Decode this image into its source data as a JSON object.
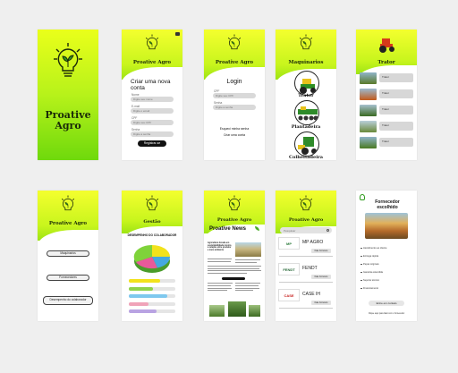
{
  "splash": {
    "title_line1": "Proative",
    "title_line2": "Agro"
  },
  "brand": {
    "name": "Proative Agro"
  },
  "register": {
    "heading": "Criar uma nova conta",
    "fields": [
      {
        "label": "Nome",
        "placeholder": "Digite seu nome"
      },
      {
        "label": "E-mail",
        "placeholder": "Digite o email"
      },
      {
        "label": "CPF",
        "placeholder": "Digite seu CPF"
      },
      {
        "label": "Senha",
        "placeholder": "Digite a senha"
      }
    ],
    "submit": "Registrar-se"
  },
  "login": {
    "heading": "Login",
    "fields": [
      {
        "label": "CPF",
        "placeholder": "Digite seu CPF"
      },
      {
        "label": "Senha",
        "placeholder": "Digite a senha"
      }
    ],
    "forgot": "Esqueci minha senha",
    "create": "Criar uma conta"
  },
  "machines": {
    "title": "Maquinarios",
    "items": [
      "Trator",
      "Plantadeira",
      "Colheitadeira"
    ]
  },
  "tractor": {
    "title": "Trator",
    "rows": [
      "Trator",
      "Trator",
      "Trator",
      "Trator",
      "Trator"
    ]
  },
  "home": {
    "buttons": [
      "Maquinarios",
      "Fornecedores",
      "Desempenho do colaborador"
    ]
  },
  "gestao": {
    "title": "Gestão",
    "chart_title": "DESEMPENHO DO COLABORADOR"
  },
  "chart_data": {
    "type": "bar",
    "title": "DESEMPENHO DO COLABORADOR",
    "series": [
      {
        "values": [
          0.68,
          0.52,
          0.82,
          0.42,
          0.6
        ]
      }
    ],
    "colors": [
      "#f2e21c",
      "#8fd34a",
      "#7ec8ee",
      "#f0a3b9",
      "#b9a3e2"
    ]
  },
  "news": {
    "title": "Proative News",
    "headline1": "Agricultura focada em sustentabilidade mostra a relação entre produtor e meio ambiente"
  },
  "suppliers": {
    "search_placeholder": "Pesquisar",
    "brands": [
      {
        "name": "MP AGRO",
        "logo": "MP",
        "action": "Fale Conosco"
      },
      {
        "name": "FENDT",
        "logo": "FENDT",
        "action": "Fale Conosco"
      },
      {
        "name": "CASE IH",
        "logo": "CASE",
        "action": "Fale Conosco"
      }
    ]
  },
  "supplier_detail": {
    "title": "Fornecedor escolhido",
    "items": [
      "Atendimento ao cliente",
      "Entrega rápida",
      "Peças originais",
      "Garantia estendida",
      "Suporte técnico",
      "Financiamento"
    ],
    "cta": "Entre em contato",
    "footer": "Clique aqui para falar com o fornecedor"
  },
  "icons": {
    "logo": "lightbulb-plant-icon",
    "tractor": "tractor-icon",
    "search": "search-icon"
  }
}
